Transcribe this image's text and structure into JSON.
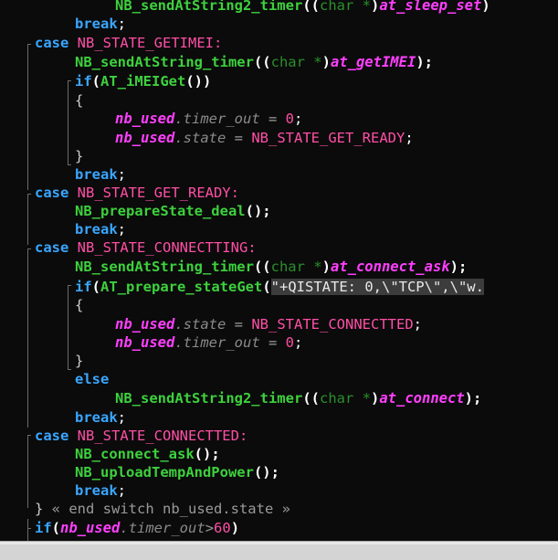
{
  "code": {
    "l0": {
      "fn": "NB_sendAtString2_timer",
      "p1": "((",
      "ty": "char *",
      "p2": ")",
      "arg": "at_sleep_set",
      "p3": ")"
    },
    "l1": {
      "kw": "case",
      "c": "NB_STATE_GETIMEI",
      "colon": ":"
    },
    "l2": {
      "fn": "NB_sendAtString_timer",
      "p1": "((",
      "ty": "char *",
      "p2": ")",
      "arg": "at_getIMEI",
      "p3": ");"
    },
    "l3": {
      "kw": "if",
      "p1": "(",
      "fn": "AT_iMEIGet",
      "p2": "()",
      "p3": ")"
    },
    "l4": {
      "br": "{"
    },
    "l5": {
      "v": "nb_used",
      "dot": ".",
      "m": "timer_out",
      "eq": " = ",
      "n": "0",
      "semi": ";"
    },
    "l6": {
      "v": "nb_used",
      "dot": ".",
      "m": "state",
      "eq": " = ",
      "c": "NB_STATE_GET_READY",
      "semi": ";"
    },
    "l7": {
      "br": "}"
    },
    "l8": {
      "kw": "break",
      "semi": ";"
    },
    "l9": {
      "kw": "case",
      "c": "NB_STATE_GET_READY",
      "colon": ":"
    },
    "l10": {
      "fn": "NB_prepareState_deal",
      "p": "();"
    },
    "l11": {
      "kw": "break",
      "semi": ";"
    },
    "l12": {
      "kw": "case",
      "c": "NB_STATE_CONNECTTING",
      "colon": ":"
    },
    "l13": {
      "fn": "NB_sendAtString_timer",
      "p1": "((",
      "ty": "char *",
      "p2": ")",
      "arg": "at_connect_ask",
      "p3": ");"
    },
    "l14": {
      "kw": "if",
      "p1": "(",
      "fn": "AT_prepare_stateGet",
      "p2": "(",
      "s": "\"+QISTATE: 0,\\\"TCP\\\",\\\"w."
    },
    "l15": {
      "br": "{"
    },
    "l16": {
      "v": "nb_used",
      "dot": ".",
      "m": "state",
      "eq": " = ",
      "c": "NB_STATE_CONNECTTED",
      "semi": ";"
    },
    "l17": {
      "v": "nb_used",
      "dot": ".",
      "m": "timer_out",
      "eq": " = ",
      "n": "0",
      "semi": ";"
    },
    "l18": {
      "br": "}"
    },
    "l19": {
      "kw": "else"
    },
    "l20": {
      "fn": "NB_sendAtString2_timer",
      "p1": "((",
      "ty": "char *",
      "p2": ")",
      "arg": "at_connect",
      "p3": ");"
    },
    "l21": {
      "kw": "break",
      "semi": ";"
    },
    "l22": {
      "kw": "case",
      "c": "NB_STATE_CONNECTTED",
      "colon": ":"
    },
    "l23": {
      "fn": "NB_connect_ask",
      "p": "();"
    },
    "l24": {
      "fn": "NB_uploadTempAndPower",
      "p": "();"
    },
    "l25": {
      "kw": "break",
      "semi": ";"
    },
    "l26": {
      "br": "}",
      "cm": " « end switch nb_used.state »"
    },
    "l27": {
      "kw": "if",
      "p1": "(",
      "v": "nb_used",
      "dot": ".",
      "m": "timer_out",
      "op": ">",
      "n": "60",
      "p2": ")"
    }
  },
  "colors": {
    "background": "#0b0b0b",
    "keyword": "#3aa6ff",
    "constant": "#ff4fa6",
    "function": "#3dd13d",
    "variable": "#ff3fff",
    "member": "#8a8a8a",
    "type": "#2b8f2b"
  }
}
